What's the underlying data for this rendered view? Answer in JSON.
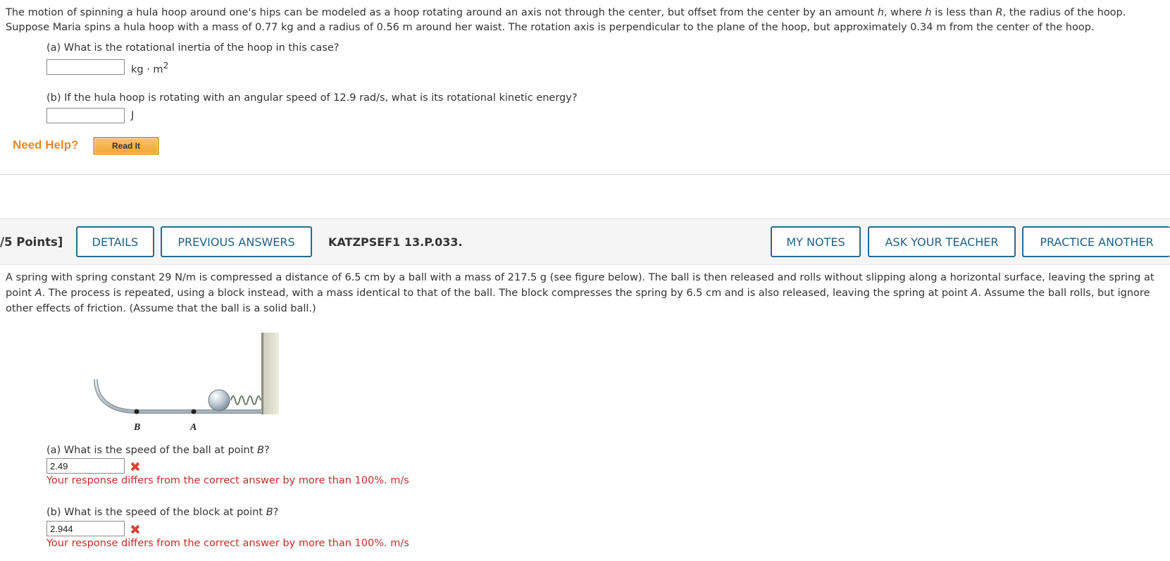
{
  "problem1": {
    "text_html": "The motion of spinning a hula hoop around one's hips can be modeled as a hoop rotating around an axis not through the center, but offset from the center by an amount <em>h</em>, where <em>h</em> is less than <em>R</em>, the radius of the hoop. Suppose Maria spins a hula hoop with a mass of 0.77 kg and a radius of 0.56 m around her waist. The rotation axis is perpendicular to the plane of the hoop, but approximately 0.34 m from the center of the hoop.",
    "part_a": {
      "label": "(a) What is the rotational inertia of the hoop in this case?",
      "value": "",
      "unit_html": "kg · m<sup>2</sup>"
    },
    "part_b": {
      "label": "(b) If the hula hoop is rotating with an angular speed of 12.9 rad/s, what is its rotational kinetic energy?",
      "value": "",
      "unit": "J"
    },
    "need_help": "Need Help?",
    "read_it": "Read It"
  },
  "problem2": {
    "points": "/5 Points]",
    "buttons": {
      "details": "DETAILS",
      "previous_answers": "PREVIOUS ANSWERS",
      "my_notes": "MY NOTES",
      "ask_teacher": "ASK YOUR TEACHER",
      "practice_another": "PRACTICE ANOTHER"
    },
    "code": "KATZPSEF1 13.P.033.",
    "text_html": "A spring with spring constant 29 N/m is compressed a distance of 6.5 cm by a ball with a mass of 217.5 g (see figure below). The ball is then released and rolls without slipping along a horizontal surface, leaving the spring at point <em>A</em>. The process is repeated, using a block instead, with a mass identical to that of the ball. The block compresses the spring by 6.5 cm and is also released, leaving the spring at point <em>A</em>. Assume the ball rolls, but ignore other effects of friction. (Assume that the ball is a solid ball.)",
    "figure": {
      "label_b": "B",
      "label_a": "A"
    },
    "part_a": {
      "label_html": "(a) What is the speed of the ball at point <em>B</em>?",
      "value": "2.49",
      "feedback": "Your response differs from the correct answer by more than 100%. m/s"
    },
    "part_b": {
      "label_html": "(b) What is the speed of the block at point <em>B</em>?",
      "value": "2.944",
      "feedback": "Your response differs from the correct answer by more than 100%. m/s"
    },
    "wrong_mark": "✖"
  }
}
